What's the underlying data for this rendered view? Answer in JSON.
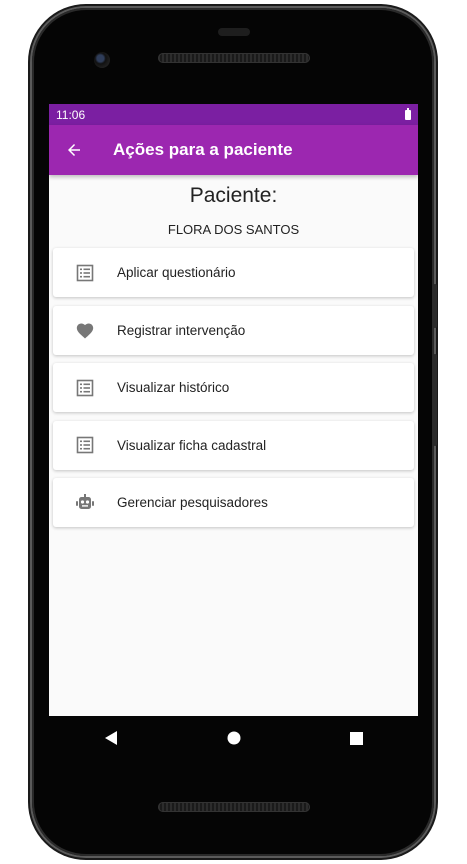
{
  "status_bar": {
    "time": "11:06"
  },
  "app_bar": {
    "title": "Ações para a paciente",
    "background": "#9c27b0",
    "status_background": "#7b1fa2"
  },
  "patient": {
    "heading": "Paciente:",
    "name": "FLORA DOS SANTOS"
  },
  "actions": [
    {
      "label": "Aplicar questionário",
      "icon": "list-icon"
    },
    {
      "label": "Registrar intervenção",
      "icon": "heart-icon"
    },
    {
      "label": "Visualizar histórico",
      "icon": "list-icon"
    },
    {
      "label": "Visualizar ficha cadastral",
      "icon": "list-icon"
    },
    {
      "label": "Gerenciar pesquisadores",
      "icon": "robot-icon"
    }
  ],
  "nav": {
    "buttons": [
      "back-triangle-icon",
      "home-circle-icon",
      "recents-square-icon"
    ]
  }
}
